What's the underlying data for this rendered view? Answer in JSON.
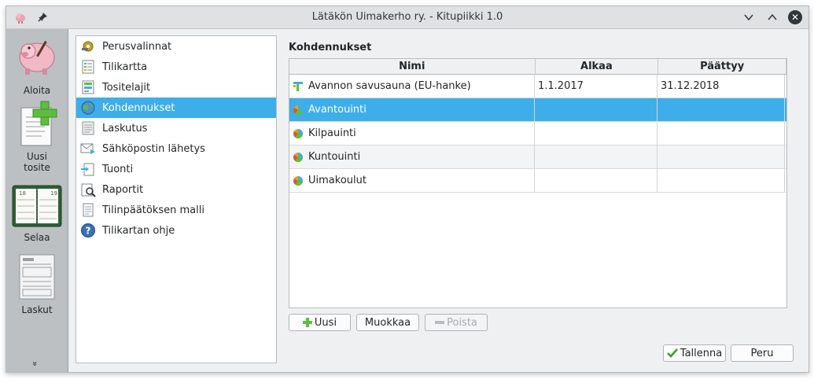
{
  "window": {
    "title": "Lätäkön Uimakerho ry. - Kitupiikki 1.0",
    "close_glyph": "✕",
    "minimize_glyph": "﹀",
    "maximize_glyph": "︿"
  },
  "sidebar": {
    "items": [
      {
        "label": "Aloita",
        "icon": "piggy-bank-icon"
      },
      {
        "label": "Uusi\ntosite",
        "icon": "new-document-icon"
      },
      {
        "label": "Selaa",
        "icon": "ledger-book-icon"
      },
      {
        "label": "Laskut",
        "icon": "invoice-icon"
      }
    ],
    "more": "»"
  },
  "nav": {
    "items": [
      {
        "label": "Perusvalinnat",
        "icon": "settings-icon"
      },
      {
        "label": "Tilikartta",
        "icon": "chart-of-accounts-icon"
      },
      {
        "label": "Tositelajit",
        "icon": "document-types-icon"
      },
      {
        "label": "Kohdennukset",
        "icon": "globe-icon"
      },
      {
        "label": "Laskutus",
        "icon": "billing-icon"
      },
      {
        "label": "Sähköpostin lähetys",
        "icon": "email-icon"
      },
      {
        "label": "Tuonti",
        "icon": "import-icon"
      },
      {
        "label": "Raportit",
        "icon": "reports-icon"
      },
      {
        "label": "Tilinpäätöksen malli",
        "icon": "template-icon"
      },
      {
        "label": "Tilikartan ohje",
        "icon": "help-icon"
      }
    ],
    "selected_index": 3
  },
  "main": {
    "title": "Kohdennukset",
    "columns": [
      "Nimi",
      "Alkaa",
      "Päättyy"
    ],
    "rows": [
      {
        "name": "Avannon savusauna (EU-hanke)",
        "start": "1.1.2017",
        "end": "31.12.2018",
        "icon": "project-icon"
      },
      {
        "name": "Avantouinti",
        "start": "",
        "end": "",
        "icon": "cost-center-icon"
      },
      {
        "name": "Kilpauinti",
        "start": "",
        "end": "",
        "icon": "cost-center-icon"
      },
      {
        "name": "Kuntouinti",
        "start": "",
        "end": "",
        "icon": "cost-center-icon"
      },
      {
        "name": "Uimakoulut",
        "start": "",
        "end": "",
        "icon": "cost-center-icon"
      }
    ],
    "selected_row": 1,
    "buttons": {
      "new": "Uusi",
      "edit": "Muokkaa",
      "delete": "Poista"
    }
  },
  "footer": {
    "save": "Tallenna",
    "cancel": "Peru"
  },
  "colors": {
    "accent": "#3daee9",
    "sidebar_bg": "#bdc0c3",
    "window_bg": "#eff0f1"
  }
}
